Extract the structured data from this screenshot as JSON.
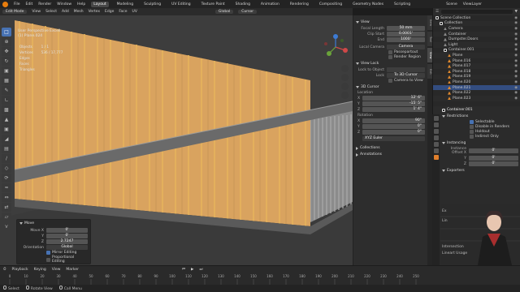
{
  "menubar": {
    "menus": [
      "File",
      "Edit",
      "Render",
      "Window",
      "Help"
    ],
    "workspaces": [
      "Layout",
      "Modeling",
      "Sculpting",
      "UV Editing",
      "Texture Paint",
      "Shading",
      "Animation",
      "Rendering",
      "Compositing",
      "Geometry Nodes",
      "Scripting"
    ],
    "active_workspace": "Layout",
    "scene": "Scene",
    "view_layer": "ViewLayer"
  },
  "viewport_header": {
    "mode": "Edit Mode",
    "menus": [
      "View",
      "Select",
      "Add",
      "Mesh",
      "Vertex",
      "Edge",
      "Face",
      "UV"
    ],
    "orientation_label": "Global",
    "pivot": "Cursor"
  },
  "viewport": {
    "view_name": "User Perspective Excell",
    "object_name": "(1) Plane.024",
    "stats": [
      {
        "label": "Objects",
        "value": "1 / 1"
      },
      {
        "label": "Vertices",
        "value": "536 / 17,777"
      },
      {
        "label": "Edges",
        "value": ""
      },
      {
        "label": "Faces",
        "value": ""
      },
      {
        "label": "Triangles",
        "value": ""
      }
    ]
  },
  "move_panel": {
    "title": "Move",
    "fields": [
      {
        "label": "Move X",
        "value": "0'"
      },
      {
        "label": "Y",
        "value": "0'"
      },
      {
        "label": "Z",
        "value": "2.7247"
      }
    ],
    "orientation_label": "Orientation",
    "orientation_value": "Global",
    "checks": [
      {
        "label": "Mirror Editing",
        "checked": true
      },
      {
        "label": "Proportional Editing",
        "checked": false
      }
    ]
  },
  "npanel": {
    "tabs": [
      "Item",
      "Tool",
      "View",
      "Edit"
    ],
    "active_tab": "View",
    "view_section": "View",
    "focal_length_label": "Focal Length",
    "focal_length": "50 mm",
    "clip_start_label": "Clip Start",
    "clip_start": "0.0001'",
    "clip_end_label": "End",
    "clip_end": "1000'",
    "local_camera_label": "Local Camera",
    "camera_value": "Camera",
    "passepartout_label": "Passepartout",
    "render_region_label": "Render Region",
    "view_lock_section": "View Lock",
    "lock_object_label": "Lock to Object",
    "lock_label": "Lock",
    "lock_3d_cursor": "To 3D Cursor",
    "camera_to_view": "Camera to View",
    "cursor_section": "3D Cursor",
    "location_label": "Location",
    "location": [
      {
        "axis": "X",
        "value": "12' 6\""
      },
      {
        "axis": "Y",
        "value": "-15' 5\""
      },
      {
        "axis": "Z",
        "value": "1' 4\""
      }
    ],
    "rotation_label": "Rotation",
    "rotation": [
      {
        "axis": "X",
        "value": "90°"
      },
      {
        "axis": "Y",
        "value": "0°"
      },
      {
        "axis": "Z",
        "value": "0°"
      }
    ],
    "rotation_mode": "XYZ Euler",
    "collections_section": "Collections",
    "annotations_section": "Annotations"
  },
  "outliner": {
    "title": "Scene Collection",
    "rows": [
      {
        "name": "Scene Collection",
        "depth": 0,
        "kind": "collection"
      },
      {
        "name": "Collection",
        "depth": 1,
        "kind": "collection"
      },
      {
        "name": "Camera",
        "depth": 2,
        "kind": "object"
      },
      {
        "name": "Container",
        "depth": 2,
        "kind": "object"
      },
      {
        "name": "Dumpster.Doors",
        "depth": 2,
        "kind": "object"
      },
      {
        "name": "Light",
        "depth": 2,
        "kind": "object"
      },
      {
        "name": "Container.001",
        "depth": 2,
        "kind": "collection"
      },
      {
        "name": "Plane",
        "depth": 3,
        "kind": "mesh"
      },
      {
        "name": "Plane.016",
        "depth": 3,
        "kind": "mesh"
      },
      {
        "name": "Plane.017",
        "depth": 3,
        "kind": "mesh"
      },
      {
        "name": "Plane.018",
        "depth": 3,
        "kind": "mesh"
      },
      {
        "name": "Plane.019",
        "depth": 3,
        "kind": "mesh"
      },
      {
        "name": "Plane.020",
        "depth": 3,
        "kind": "mesh"
      },
      {
        "name": "Plane.021",
        "depth": 3,
        "kind": "mesh"
      },
      {
        "name": "Plane.022",
        "depth": 3,
        "kind": "mesh"
      },
      {
        "name": "Plane.023",
        "depth": 3,
        "kind": "mesh"
      }
    ],
    "selected_index": 13
  },
  "properties": {
    "object_name": "Container.001",
    "relations_section": "Restrictions",
    "checks": [
      {
        "label": "Selectable",
        "checked": true
      },
      {
        "label": "Disable in Renders",
        "checked": false
      },
      {
        "label": "Holdout",
        "checked": false
      },
      {
        "label": "Indirect Only",
        "checked": false
      }
    ],
    "instancing_section": "Instancing",
    "instance_offset_label": "Instance Offset X",
    "instance_offset": [
      {
        "axis": "X",
        "value": "0'"
      },
      {
        "axis": "Y",
        "value": "0'"
      },
      {
        "axis": "Z",
        "value": "0'"
      }
    ],
    "exporters_section": "Exporters",
    "other_labels": [
      "Ex",
      "Lin",
      "Intersection",
      "Lineart Usage"
    ]
  },
  "timeline": {
    "menus": [
      "Playback",
      "Keying",
      "View",
      "Marker"
    ],
    "frame_ticks": [
      "0",
      "10",
      "20",
      "30",
      "40",
      "50",
      "60",
      "70",
      "80",
      "90",
      "100",
      "110",
      "120",
      "130",
      "140",
      "150",
      "160",
      "170",
      "180",
      "190",
      "200",
      "210",
      "220",
      "230",
      "240",
      "250"
    ]
  },
  "statusbar": {
    "items": [
      "Select",
      "Rotate View",
      "Call Menu"
    ]
  },
  "colors": {
    "selected_face": "#e6a23c",
    "face_orange": "#d99a4e",
    "accent_blue": "#4772b3",
    "panel_bg": "#2d2d2d",
    "viewport_bg": "#3d3d3d"
  }
}
